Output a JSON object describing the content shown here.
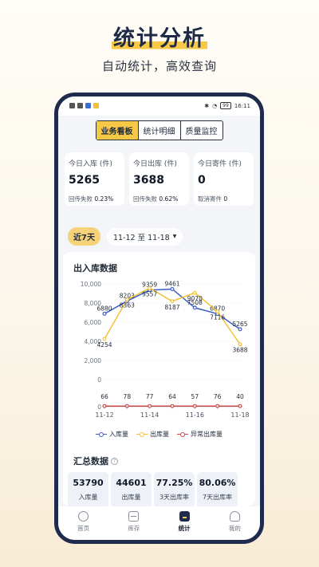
{
  "promo": {
    "title": "统计分析",
    "subtitle": "自动统计，高效查询"
  },
  "status_bar": {
    "battery": "99",
    "time": "16:11"
  },
  "tabs": [
    {
      "label": "业务看板",
      "active": true
    },
    {
      "label": "统计明细",
      "active": false
    },
    {
      "label": "质量监控",
      "active": false
    }
  ],
  "cards": [
    {
      "title": "今日入库 (件)",
      "value": "5265",
      "foot_label": "回传失败",
      "foot_value": "0.23%"
    },
    {
      "title": "今日出库 (件)",
      "value": "3688",
      "foot_label": "回传失败",
      "foot_value": "0.62%"
    },
    {
      "title": "今日寄件 (件)",
      "value": "0",
      "foot_label": "取消寄件",
      "foot_value": "0"
    }
  ],
  "filter": {
    "period": "近7天",
    "range": "11-12 至 11-18"
  },
  "chart_title": "出入库数据",
  "chart_data": {
    "type": "line",
    "x": [
      "11-12",
      "11-13",
      "11-14",
      "11-15",
      "11-16",
      "11-17",
      "11-18"
    ],
    "x_tick_labels": [
      "11-12",
      "11-14",
      "11-16",
      "11-18"
    ],
    "upper_ylim": [
      0,
      10000
    ],
    "upper_yticks": [
      "0",
      "2,000",
      "4,000",
      "6,000",
      "8,000",
      "10,000"
    ],
    "lower_ytick": "0",
    "series": [
      {
        "name": "入库量",
        "color": "#3b5cc4",
        "values": [
          6880,
          8203,
          9359,
          9461,
          7508,
          6870,
          5265
        ],
        "panel": "upper"
      },
      {
        "name": "出库量",
        "color": "#f2c23a",
        "values": [
          4254,
          8363,
          9557,
          8187,
          9070,
          7116,
          3688
        ],
        "panel": "upper"
      },
      {
        "name": "异常出库量",
        "color": "#c94a4a",
        "values": [
          66,
          78,
          77,
          64,
          57,
          76,
          40
        ],
        "panel": "lower"
      }
    ],
    "grid": true,
    "legend": "bottom"
  },
  "summary": {
    "title": "汇总数据",
    "stats": [
      {
        "value": "53790",
        "label": "入库量"
      },
      {
        "value": "44601",
        "label": "出库量"
      },
      {
        "value": "77.25%",
        "label": "3天出库率"
      },
      {
        "value": "80.06%",
        "label": "7天出库率"
      }
    ]
  },
  "nav": [
    {
      "label": "首页",
      "icon": "home-icon",
      "active": false
    },
    {
      "label": "库存",
      "icon": "inventory-icon",
      "active": false
    },
    {
      "label": "统计",
      "icon": "stats-icon",
      "active": true
    },
    {
      "label": "我的",
      "icon": "profile-icon",
      "active": false
    }
  ]
}
